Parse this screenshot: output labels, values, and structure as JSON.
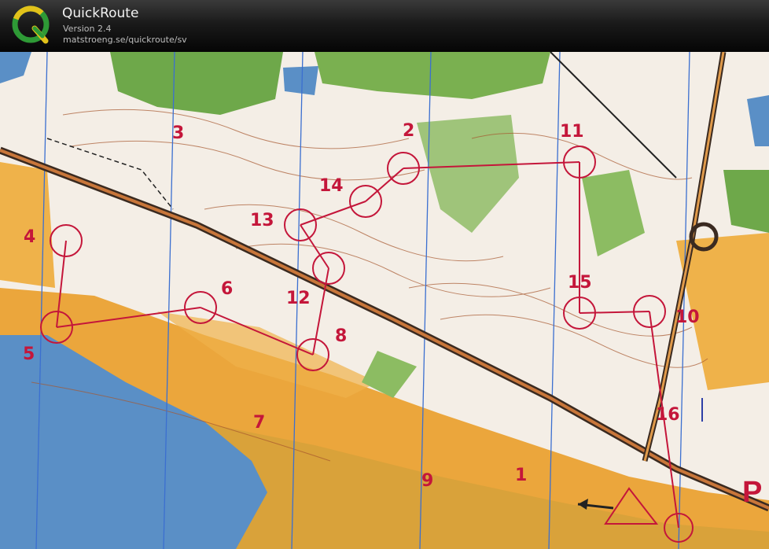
{
  "app": {
    "name": "QuickRoute",
    "version": "Version 2.4",
    "url": "matstroeng.se/quickroute/sv"
  },
  "map": {
    "control_numbers": [
      "1",
      "2",
      "3",
      "4",
      "5",
      "6",
      "7",
      "8",
      "9",
      "10",
      "11",
      "12",
      "13",
      "14",
      "15",
      "16"
    ],
    "parking_letter": "P"
  },
  "colors": {
    "control": "#c4163a",
    "water": "#5a8fc6",
    "forest_green": "#6ea84a",
    "yellow_open": "#e8a63a",
    "white_forest": "#f4eee6",
    "north_lines": "#3b6fd0"
  }
}
